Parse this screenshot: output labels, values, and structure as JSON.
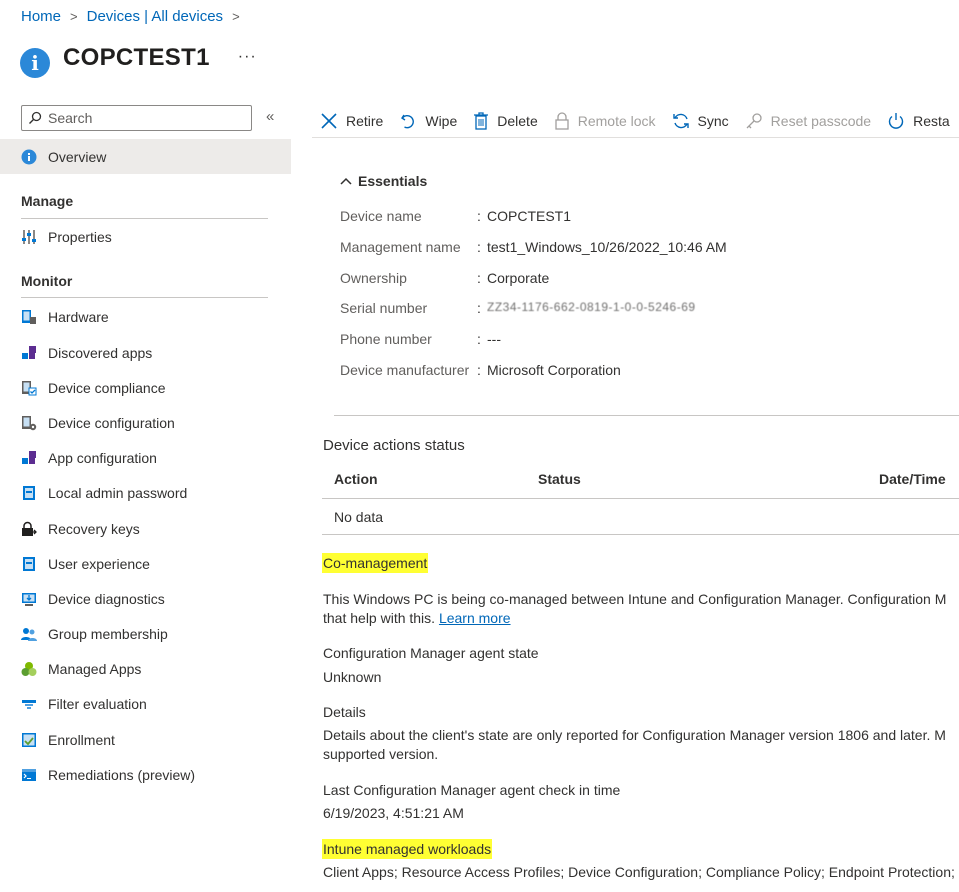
{
  "breadcrumb": {
    "home": "Home",
    "devices": "Devices | All devices"
  },
  "page": {
    "title": "COPCTEST1",
    "more": "···"
  },
  "search": {
    "placeholder": "Search",
    "collapse": "«"
  },
  "nav": {
    "overview": "Overview",
    "manage_heading": "Manage",
    "properties": "Properties",
    "monitor_heading": "Monitor",
    "items": [
      "Hardware",
      "Discovered apps",
      "Device compliance",
      "Device configuration",
      "App configuration",
      "Local admin password",
      "Recovery keys",
      "User experience",
      "Device diagnostics",
      "Group membership",
      "Managed Apps",
      "Filter evaluation",
      "Enrollment",
      "Remediations (preview)"
    ]
  },
  "toolbar": {
    "retire": "Retire",
    "wipe": "Wipe",
    "delete": "Delete",
    "remote_lock": "Remote lock",
    "sync": "Sync",
    "reset_passcode": "Reset passcode",
    "restart": "Resta"
  },
  "essentials": {
    "heading": "Essentials",
    "rows": [
      {
        "label": "Device name",
        "value": "COPCTEST1"
      },
      {
        "label": "Management name",
        "value": "test1_Windows_10/26/2022_10:46 AM"
      },
      {
        "label": "Ownership",
        "value": "Corporate"
      },
      {
        "label": "Serial number",
        "value": "ZZ34-1176-662-0819-1-0-0-5246-69"
      },
      {
        "label": "Phone number",
        "value": "---"
      },
      {
        "label": "Device manufacturer",
        "value": "Microsoft Corporation"
      }
    ]
  },
  "device_actions": {
    "title": "Device actions status",
    "col_action": "Action",
    "col_status": "Status",
    "col_datetime": "Date/Time",
    "empty": "No data"
  },
  "comanagement": {
    "heading": "Co-management",
    "desc_line1": "This Windows PC is being co-managed between Intune and Configuration Manager. Configuration M",
    "desc_line2": "that help with this.",
    "learn_more": "Learn more",
    "agent_state_label": "Configuration Manager agent state",
    "agent_state_value": "Unknown",
    "details_label": "Details",
    "details_line1": "Details about the client's state are only reported for Configuration Manager version 1806 and later. M",
    "details_line2": "supported version.",
    "last_checkin_label": "Last Configuration Manager agent check in time",
    "last_checkin_value": "6/19/2023, 4:51:21 AM",
    "workloads_heading": "Intune managed workloads",
    "workloads_value": "Client Apps; Resource Access Profiles; Device Configuration; Compliance Policy; Endpoint Protection; C"
  }
}
